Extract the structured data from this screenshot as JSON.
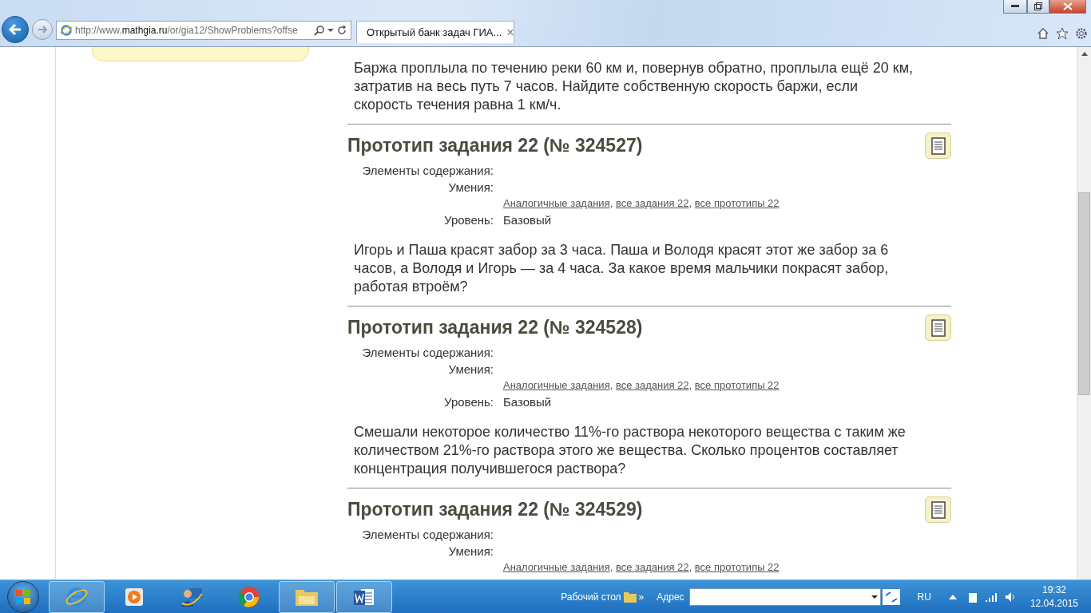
{
  "browser": {
    "address": {
      "prefix": "http://www.",
      "domain": "mathgia.ru",
      "path": "/or/gia12/ShowProblems?offse"
    },
    "tabs": [
      {
        "title": "Открытый банк задач ГИА...",
        "selected": true,
        "close": "×"
      }
    ]
  },
  "intro_text": "Баржа проплыла по течению реки 60 км и, повернув обратно, проплыла ещё 20 км, затратив на весь путь 7 часов. Найдите собственную скорость баржи, если скорость течения равна 1 км/ч.",
  "problems": [
    {
      "title": "Прототип задания 22 (№ 324527)",
      "content_label": "Элементы содержания:",
      "skills_label": "Умения:",
      "links": [
        "Аналогичные задания",
        "все задания 22",
        "все прототипы 22"
      ],
      "link_separator": ",",
      "level_label": "Уровень:",
      "level_value": "Базовый",
      "text": "Игорь и Паша красят забор за 3 часа. Паша и Володя красят этот же забор за 6 часов, а Володя и Игорь — за 4 часа. За какое время мальчики покрасят забор, работая втроём?"
    },
    {
      "title": "Прототип задания 22 (№ 324528)",
      "content_label": "Элементы содержания:",
      "skills_label": "Умения:",
      "links": [
        "Аналогичные задания",
        "все задания 22",
        "все прототипы 22"
      ],
      "link_separator": ",",
      "level_label": "Уровень:",
      "level_value": "Базовый",
      "text": "Смешали некоторое количество 11%-го раствора некоторого вещества с таким же количеством 21%-го раствора этого же вещества. Сколько процентов составляет концентрация получившегося раствора?"
    },
    {
      "title": "Прототип задания 22 (№ 324529)",
      "content_label": "Элементы содержания:",
      "skills_label": "Умения:",
      "links": [
        "Аналогичные задания",
        "все задания 22",
        "все прототипы 22"
      ],
      "link_separator": ","
    }
  ],
  "taskbar": {
    "apps": [
      {
        "kind": "ie",
        "open": true
      },
      {
        "kind": "media",
        "open": false
      },
      {
        "kind": "user",
        "open": false
      },
      {
        "kind": "chrome",
        "open": false
      },
      {
        "kind": "folder",
        "open": true
      },
      {
        "kind": "word",
        "open": true
      }
    ],
    "desktop_label": "Рабочий стол",
    "chevron": "»",
    "address_label": "Адрес",
    "language": "RU",
    "time": "19:32",
    "date": "12.04.2015"
  }
}
